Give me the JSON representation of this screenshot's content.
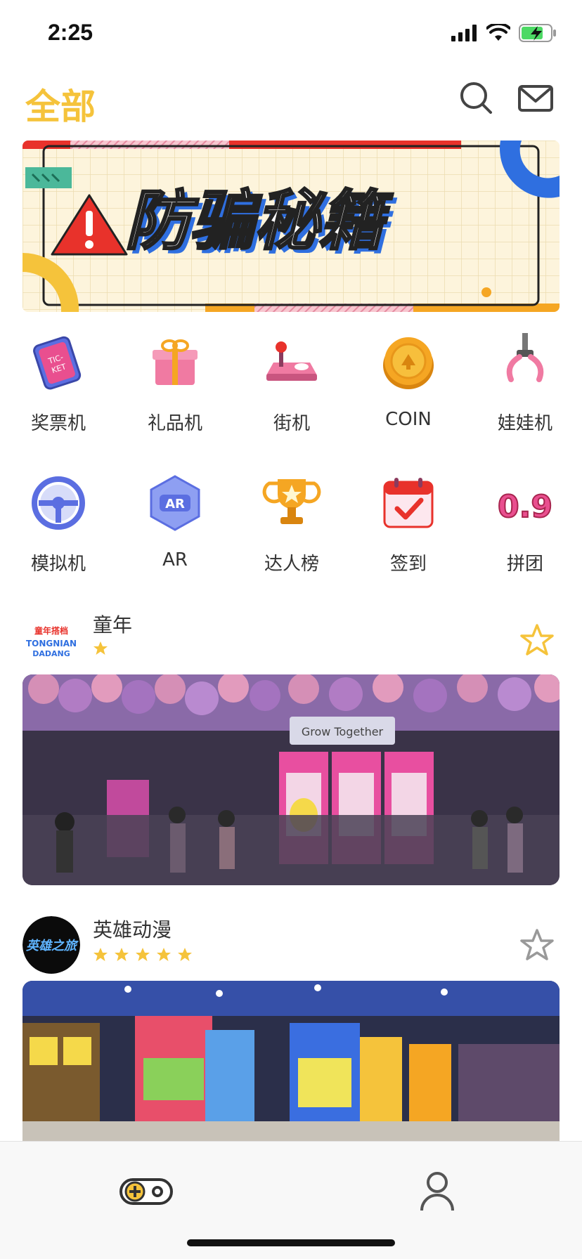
{
  "status": {
    "time": "2:25"
  },
  "header": {
    "title": "全部"
  },
  "categories": [
    {
      "label": "奖票机",
      "icon": "ticket-icon"
    },
    {
      "label": "礼品机",
      "icon": "gift-icon"
    },
    {
      "label": "街机",
      "icon": "joystick-icon"
    },
    {
      "label": "COIN",
      "icon": "coin-icon"
    },
    {
      "label": "娃娃机",
      "icon": "claw-icon"
    },
    {
      "label": "模拟机",
      "icon": "steering-wheel-icon"
    },
    {
      "label": "AR",
      "icon": "ar-icon"
    },
    {
      "label": "达人榜",
      "icon": "trophy-icon"
    },
    {
      "label": "签到",
      "icon": "calendar-check-icon"
    },
    {
      "label": "拼团",
      "icon": "group-buy-icon"
    }
  ],
  "arcades": [
    {
      "name": "童年",
      "rating": 1,
      "favorited": true,
      "logo_text": "童年搭档 TONGNIAN DADANG"
    },
    {
      "name": "英雄动漫",
      "rating": 5,
      "favorited": false,
      "logo_text": "英雄之旅"
    }
  ],
  "tabs": [
    {
      "name": "game",
      "icon": "gamepad-icon"
    },
    {
      "name": "profile",
      "icon": "user-icon"
    }
  ],
  "colors": {
    "accent": "#f5c33b",
    "star": "#f5c33b",
    "star_off": "#999999"
  }
}
